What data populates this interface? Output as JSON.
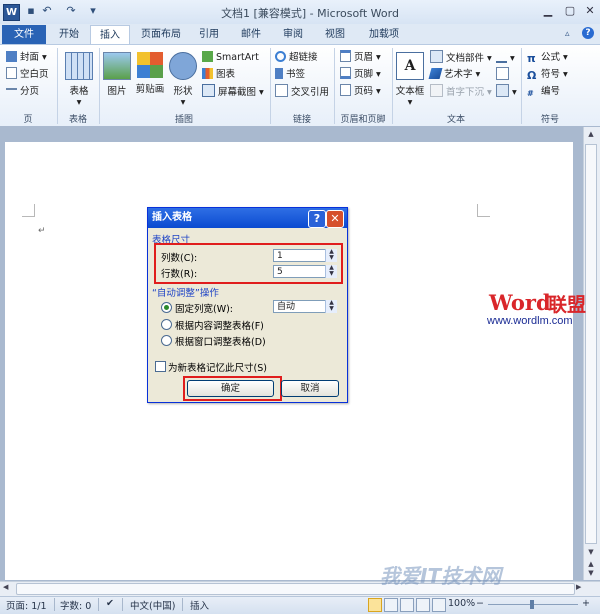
{
  "window": {
    "title": "文档1 [兼容模式] - Microsoft Word",
    "app_logo": "W",
    "qat_icons": [
      "save-icon",
      "undo-icon",
      "redo-icon",
      "customize-icon"
    ]
  },
  "tabs": {
    "file": "文件",
    "items": [
      "开始",
      "插入",
      "页面布局",
      "引用",
      "邮件",
      "审阅",
      "视图",
      "加载项"
    ],
    "active": "插入"
  },
  "ribbon": {
    "groups": {
      "pages": {
        "label": "页",
        "items": [
          "封面",
          "空白页",
          "分页"
        ]
      },
      "tables": {
        "label": "表格",
        "button": "表格"
      },
      "illustrations": {
        "label": "插图",
        "large": [
          "图片",
          "剪贴画",
          "形状"
        ],
        "small": [
          "SmartArt",
          "图表",
          "屏幕截图"
        ]
      },
      "links": {
        "label": "链接",
        "items": [
          "超链接",
          "书签",
          "交叉引用"
        ]
      },
      "header_footer": {
        "label": "页眉和页脚",
        "items": [
          "页眉",
          "页脚",
          "页码"
        ]
      },
      "text": {
        "label": "文本",
        "large": "文本框",
        "items": [
          "文档部件",
          "艺术字",
          "首字下沉"
        ]
      },
      "symbols": {
        "label": "符号",
        "items": [
          "公式",
          "符号",
          "编号"
        ]
      }
    },
    "colors": {
      "file_tab": "#2a63b5",
      "ribbon_bg": "#e7eff9"
    }
  },
  "dialog": {
    "title": "插入表格",
    "help": "?",
    "close": "✕",
    "table_size": {
      "section": "表格尺寸",
      "columns_label": "列数(C):",
      "columns_value": "1",
      "rows_label": "行数(R):",
      "rows_value": "5"
    },
    "autofit": {
      "section": "“自动调整”操作",
      "fixed_width_label": "固定列宽(W):",
      "fixed_width_value": "自动",
      "by_content_label": "根据内容调整表格(F)",
      "by_window_label": "根据窗口调整表格(D)",
      "selected": "fixed_width"
    },
    "remember_label": "为新表格记忆此尺寸(S)",
    "remember_checked": false,
    "ok_label": "确定",
    "cancel_label": "取消"
  },
  "document": {
    "paragraph_mark": "↵"
  },
  "watermark": {
    "brand_word": "Word",
    "brand_cn": "联盟",
    "url": "www.wordlm.com",
    "bottom_text": "我爱IT技术网"
  },
  "statusbar": {
    "page": "页面: 1/1",
    "words": "字数: 0",
    "language": "中文(中国)",
    "mode": "插入",
    "zoom": "100%"
  }
}
